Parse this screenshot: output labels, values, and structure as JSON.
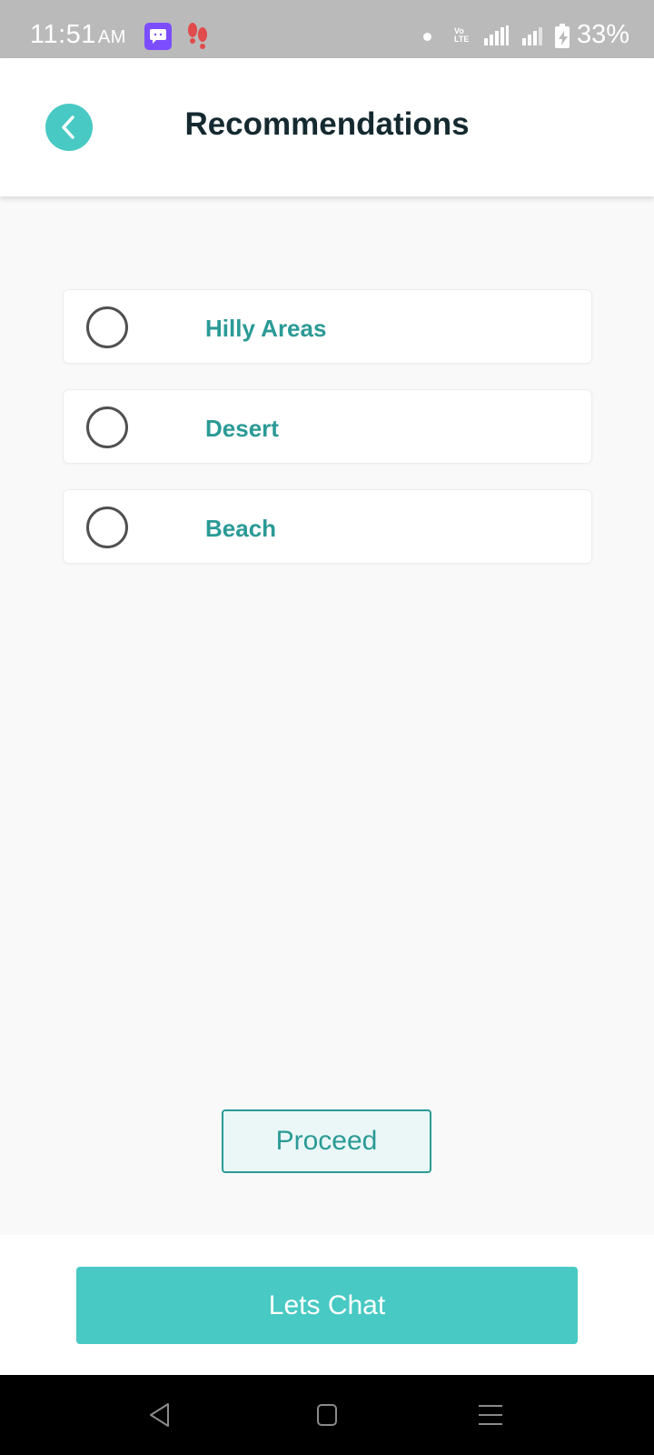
{
  "status_bar": {
    "time": "11:51",
    "ampm": "AM",
    "volte": "Vo LTE",
    "battery": "33%",
    "icons": [
      "chat-app-icon",
      "footsteps-icon",
      "dot-icon",
      "volte-icon",
      "signal-icon",
      "signal-lte-icon",
      "battery-charging-icon"
    ]
  },
  "header": {
    "title": "Recommendations",
    "back_icon": "chevron-left-icon"
  },
  "options": [
    {
      "label": "Hilly Areas",
      "selected": false
    },
    {
      "label": "Desert",
      "selected": false
    },
    {
      "label": "Beach",
      "selected": false
    }
  ],
  "actions": {
    "proceed_label": "Proceed",
    "chat_label": "Lets Chat"
  },
  "colors": {
    "accent": "#48c9c3",
    "accent_dark": "#2b9a96",
    "title": "#142a30",
    "background": "#f9f9f9"
  }
}
